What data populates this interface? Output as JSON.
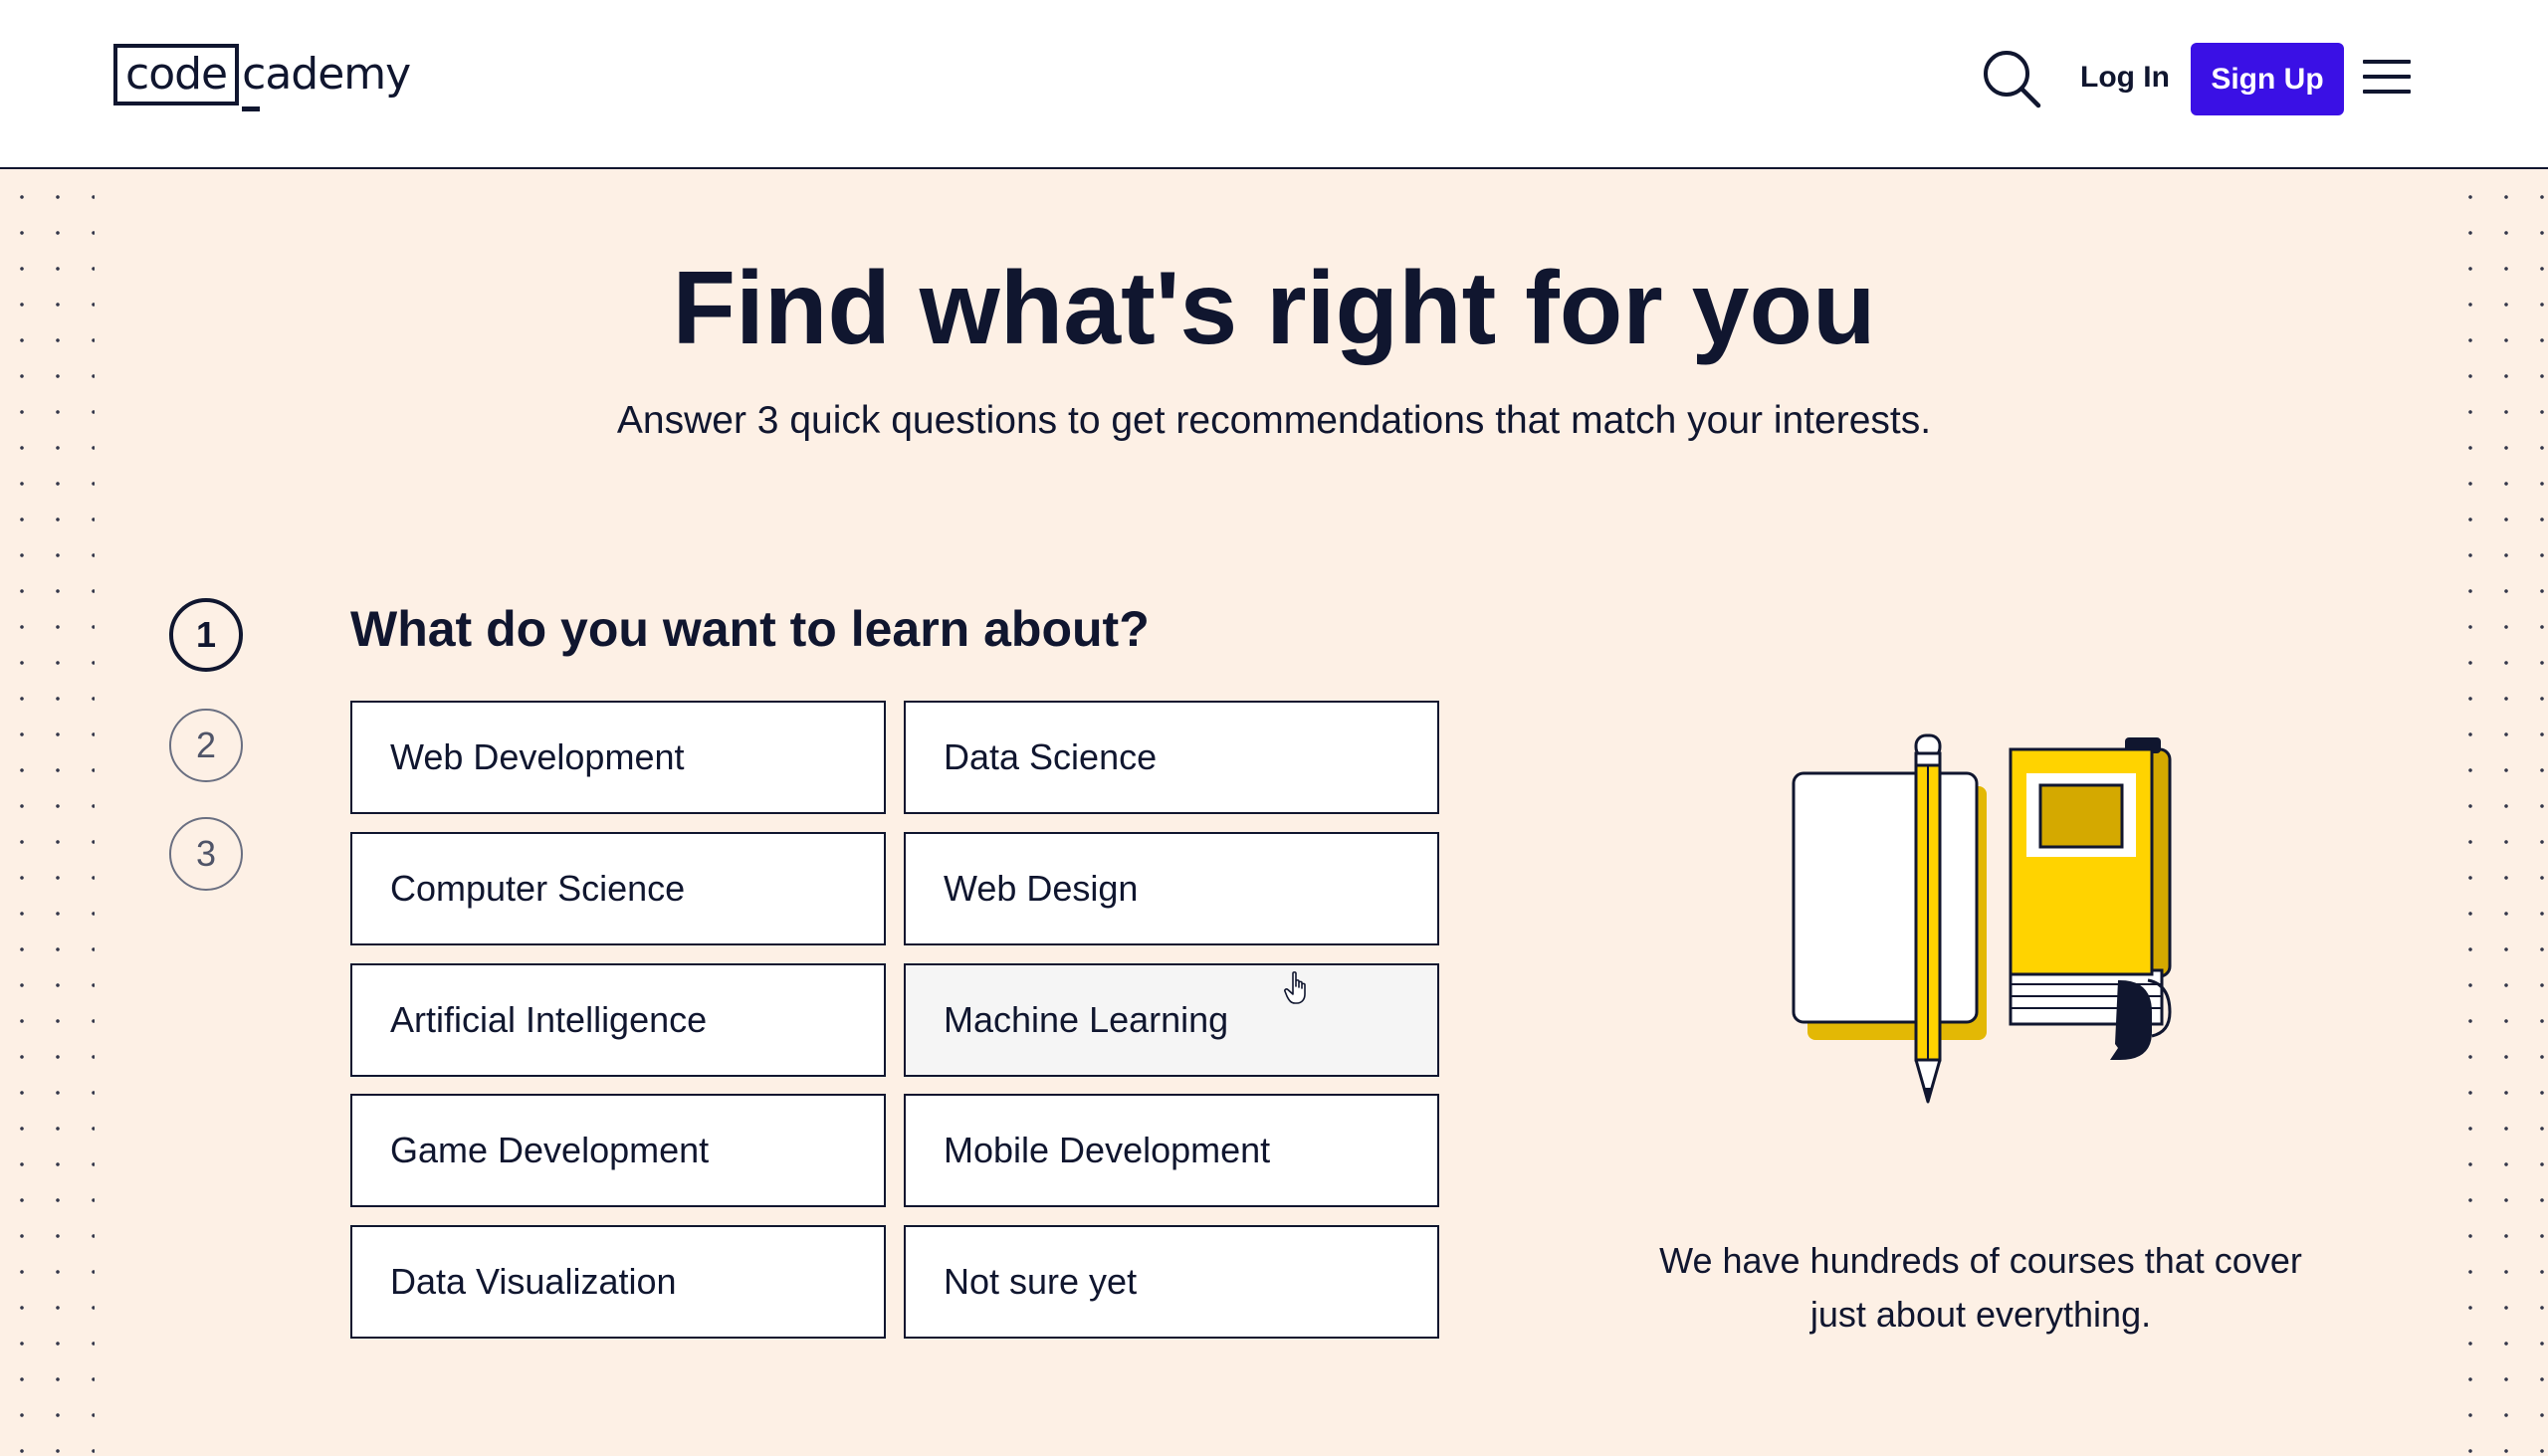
{
  "header": {
    "logo_part1": "code",
    "logo_part2": "cademy",
    "login_label": "Log In",
    "signup_label": "Sign Up"
  },
  "hero": {
    "title": "Find what's right for you",
    "subtitle": "Answer 3 quick questions to get recommendations that match your interests."
  },
  "steps": [
    "1",
    "2",
    "3"
  ],
  "question": "What do you want to learn about?",
  "options": [
    "Web Development",
    "Data Science",
    "Computer Science",
    "Web Design",
    "Artificial Intelligence",
    "Machine Learning",
    "Game Development",
    "Mobile Development",
    "Data Visualization",
    "Not sure yet"
  ],
  "side_text": "We have hundreds of courses that cover just about everything.",
  "colors": {
    "background": "#fdf0e5",
    "navy": "#10162f",
    "brand_blue": "#3a10e5",
    "accent_yellow": "#ffd300"
  },
  "icons": [
    "search-icon",
    "menu-icon",
    "pointer-cursor-icon",
    "books-pencil-illustration"
  ]
}
